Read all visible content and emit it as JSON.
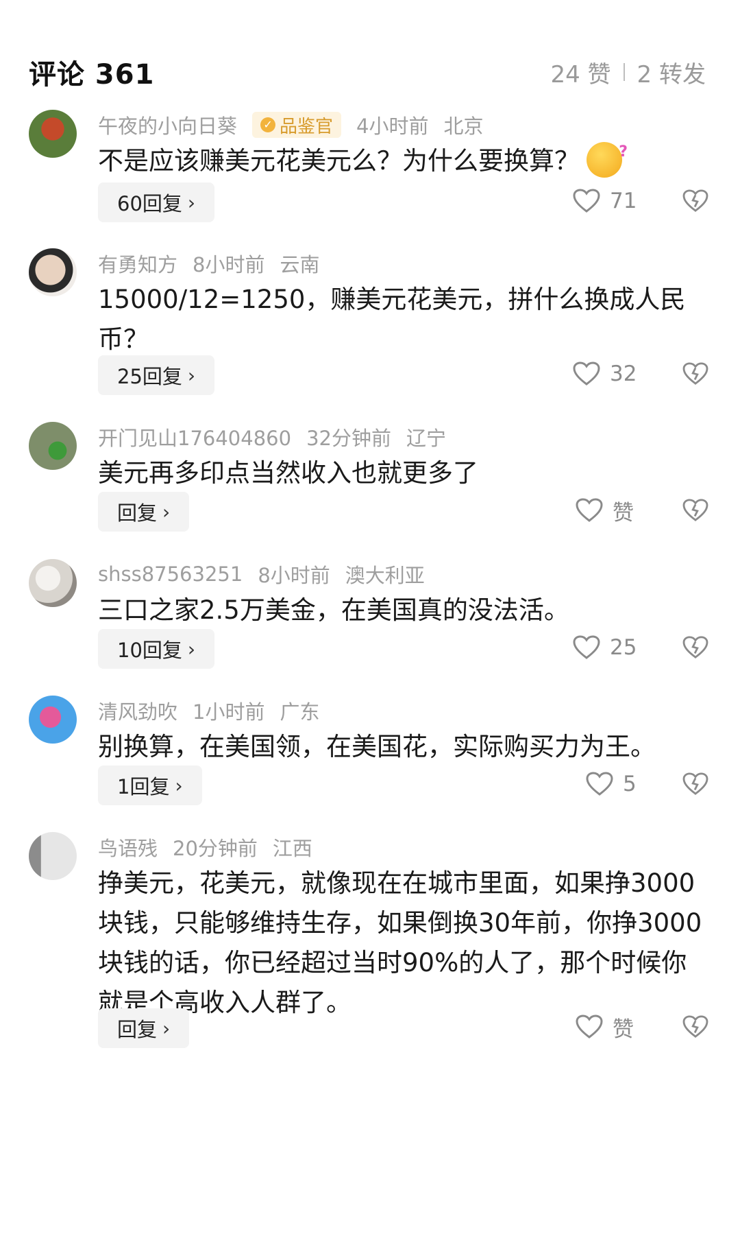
{
  "header": {
    "title": "评论 361",
    "likes": "24 赞",
    "shares": "2 转发"
  },
  "comments": [
    {
      "username": "午夜的小向日葵",
      "badge": "品鉴官",
      "time": "4小时前",
      "location": "北京",
      "text": "不是应该赚美元花美元么？为什么要换算？",
      "reply_label": "60回复",
      "like_count": "71",
      "avatar_colors": [
        "#5a7d3a",
        "#c44a2a"
      ]
    },
    {
      "username": "有勇知方",
      "time": "8小时前",
      "location": "云南",
      "text": "15000/12=1250，赚美元花美元，拼什么换成人民币？",
      "reply_label": "25回复",
      "like_count": "32",
      "avatar_colors": [
        "#e8d2c0",
        "#2b2b2b"
      ]
    },
    {
      "username": "开门见山176404860",
      "time": "32分钟前",
      "location": "辽宁",
      "text": "美元再多印点当然收入也就更多了",
      "reply_label": "回复",
      "like_count": "赞",
      "avatar_colors": [
        "#7e8e6a",
        "#3e9a3a"
      ]
    },
    {
      "username": "shss87563251",
      "time": "8小时前",
      "location": "澳大利亚",
      "text": "三口之家2.5万美金，在美国真的没法活。",
      "reply_label": "10回复",
      "like_count": "25",
      "avatar_colors": [
        "#d9d5cf",
        "#8f8a84"
      ]
    },
    {
      "username": "清风劲吹",
      "time": "1小时前",
      "location": "广东",
      "text": "别换算，在美国领，在美国花，实际购买力为王。",
      "reply_label": "1回复",
      "like_count": "5",
      "avatar_colors": [
        "#4aa3e8",
        "#e45a9a"
      ]
    },
    {
      "username": "鸟语残",
      "time": "20分钟前",
      "location": "江西",
      "text": "挣美元，花美元，就像现在在城市里面，如果挣3000块钱，只能够维持生存，如果倒换30年前，你挣3000块钱的话，你已经超过当时90%的人了，那个时候你就是个高收入人群了。",
      "reply_label": "回复",
      "like_count": "赞",
      "avatar_colors": [
        "#e6e6e6",
        "#8c8c8c"
      ]
    }
  ]
}
